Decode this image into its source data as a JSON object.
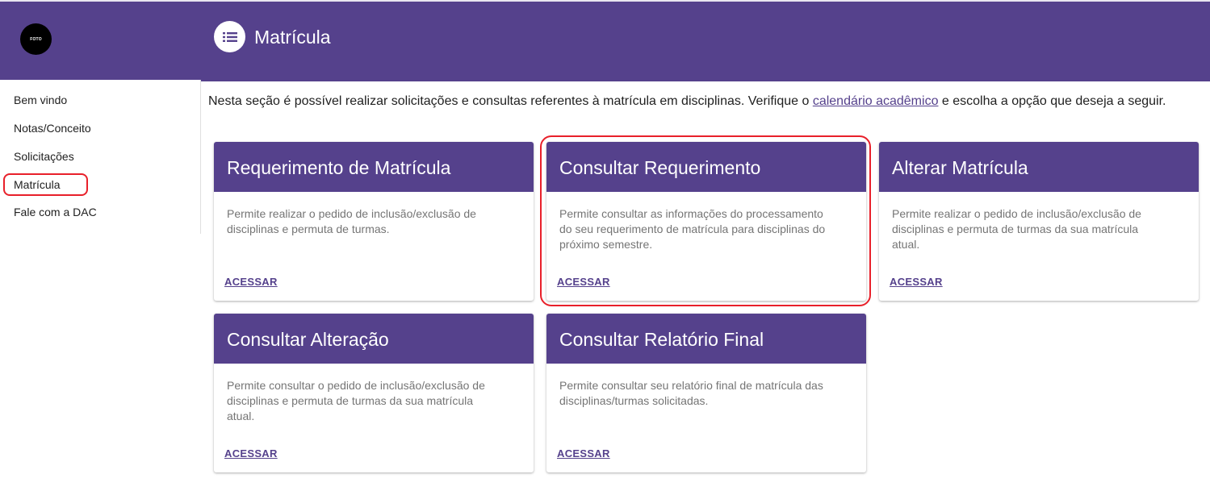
{
  "sidebar": {
    "avatar_text": "FOTO",
    "items": [
      {
        "label": "Bem vindo"
      },
      {
        "label": "Notas/Conceito"
      },
      {
        "label": "Solicitações"
      },
      {
        "label": "Matrícula"
      },
      {
        "label": "Fale com a DAC"
      }
    ],
    "active_item": "Matrícula"
  },
  "header": {
    "title": "Matrícula",
    "icon": "list-icon"
  },
  "intro": {
    "before": "Nesta seção é possível realizar solicitações e consultas referentes à matrícula em disciplinas. Verifique o ",
    "link": "calendário acadêmico",
    "after": " e escolha a opção que deseja a seguir."
  },
  "cards": [
    {
      "title": "Requerimento de Matrícula",
      "text": "Permite realizar o pedido de inclusão/exclusão de disciplinas e permuta de turmas.",
      "action": "ACESSAR"
    },
    {
      "title": "Consultar Requerimento",
      "text": "Permite consultar as informações do processamento do seu requerimento de matrícula para disciplinas do próximo semestre.",
      "action": "ACESSAR"
    },
    {
      "title": "Alterar Matrícula",
      "text": "Permite realizar o pedido de inclusão/exclusão de disciplinas e permuta de turmas da sua matrícula atual.",
      "action": "ACESSAR"
    },
    {
      "title": "Consultar Alteração",
      "text": "Permite consultar o pedido de inclusão/exclusão de disciplinas e permuta de turmas da sua matrícula atual.",
      "action": "ACESSAR"
    },
    {
      "title": "Consultar Relatório Final",
      "text": "Permite consultar seu relatório final de matrícula das disciplinas/turmas solicitadas.",
      "action": "ACESSAR"
    }
  ],
  "colors": {
    "brand": "#55418c",
    "annotation": "#e8202a"
  }
}
